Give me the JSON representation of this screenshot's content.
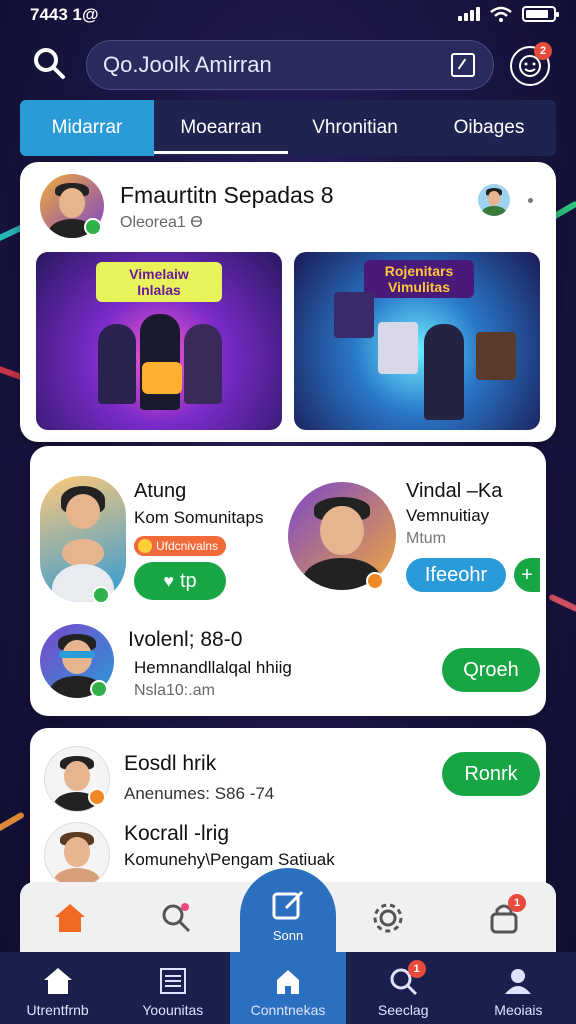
{
  "status_bar": {
    "time": "7443 1@"
  },
  "header": {
    "search_placeholder": "Qo.Joolk Amirran",
    "notification_count": "2"
  },
  "tabs": [
    {
      "label": "Midarrar"
    },
    {
      "label": "Moearran"
    },
    {
      "label": "Vhronitian"
    },
    {
      "label": "Oibages"
    }
  ],
  "post": {
    "author": "Fmaurtitn Sepadas 8",
    "subtitle": "Oleoreа1 Ө",
    "promo_left_title": [
      "Vimelaiw",
      "Inlalas"
    ],
    "promo_right_title": [
      "Rojenitars",
      "Vimulitas"
    ]
  },
  "suggestions": {
    "left": {
      "name": "Atung",
      "desc": "Kom Somunitaps",
      "tag": "Ufdcnivalns",
      "button": "tp"
    },
    "right": {
      "name": "Vindal –Ka",
      "desc": "Vemnuitiay",
      "sub": "Mtum",
      "button": "Ifeeohr"
    },
    "row": {
      "name": "Ivolenl; 88-0",
      "desc": "Hemnandllalqal hhiig",
      "time": "Nsla10:.am",
      "button": "Qroeh"
    }
  },
  "people": [
    {
      "name": "Eosdl hrik",
      "desc": "Anenumes: S86 -74",
      "button": "Ronrk"
    },
    {
      "name": "Kocrall -lrig",
      "desc": "Komunehy\\Pengam Satiuak"
    }
  ],
  "fab_label": "Sonn",
  "bottom_nav": [
    {
      "label": "Utrentfrnb",
      "icon": "home-icon"
    },
    {
      "label": "Yoounitas",
      "icon": "list-icon"
    },
    {
      "label": "Conntnekas",
      "icon": "community-icon"
    },
    {
      "label": "Seeclag",
      "icon": "search-icon",
      "badge": "1"
    },
    {
      "label": "Meoiais",
      "icon": "profile-icon"
    }
  ],
  "colors": {
    "accent": "#2a9bd6",
    "green": "#18a544",
    "badge": "#e84a3b",
    "nav_bg": "#1b1f4d"
  }
}
